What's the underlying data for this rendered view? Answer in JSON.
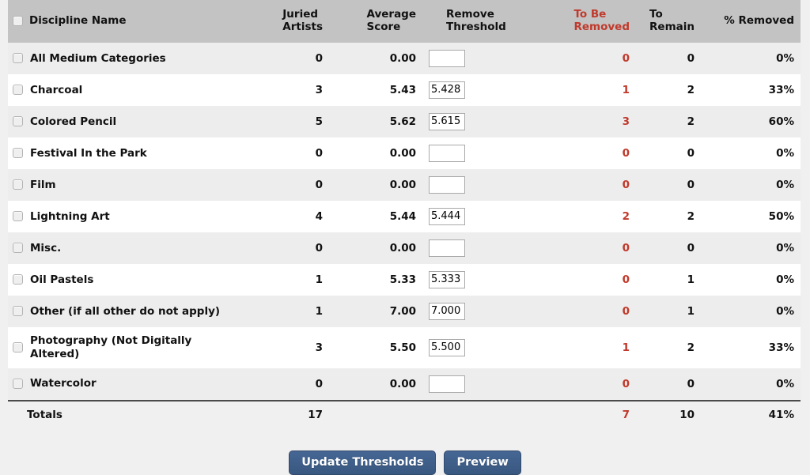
{
  "table": {
    "columns": [
      {
        "key": "name",
        "label": "Discipline Name",
        "align": "left",
        "red": false
      },
      {
        "key": "juried",
        "label": "Juried Artists",
        "align": "right",
        "red": false
      },
      {
        "key": "avg",
        "label": "Average Score",
        "align": "right",
        "red": false
      },
      {
        "key": "threshold",
        "label": "Remove Threshold",
        "align": "right",
        "red": false
      },
      {
        "key": "to_remove",
        "label": "To Be Removed",
        "align": "right",
        "red": true
      },
      {
        "key": "to_remain",
        "label": "To Remain",
        "align": "right",
        "red": false
      },
      {
        "key": "pct_removed",
        "label": "% Removed",
        "align": "right",
        "red": false
      }
    ],
    "header": {
      "discipline_name": "Discipline Name",
      "juried_artists_l1": "Juried",
      "juried_artists_l2": "Artists",
      "average_score_l1": "Average",
      "average_score_l2": "Score",
      "remove_threshold_l1": "Remove",
      "remove_threshold_l2": "Threshold",
      "to_be_removed_l1": "To Be",
      "to_be_removed_l2": "Removed",
      "to_remain_l1": "To",
      "to_remain_l2": "Remain",
      "pct_removed": "% Removed",
      "select_all_checkbox": "unchecked"
    },
    "rows": [
      {
        "name": "All Medium Categories",
        "juried": "0",
        "avg": "0.00",
        "threshold": "",
        "threshold_placeholder": "",
        "to_remove": "0",
        "to_remain": "0",
        "pct_removed": "0%"
      },
      {
        "name": "Charcoal",
        "juried": "3",
        "avg": "5.43",
        "threshold": "5.428",
        "threshold_placeholder": "",
        "to_remove": "1",
        "to_remain": "2",
        "pct_removed": "33%"
      },
      {
        "name": "Colored Pencil",
        "juried": "5",
        "avg": "5.62",
        "threshold": "5.615",
        "threshold_placeholder": "",
        "to_remove": "3",
        "to_remain": "2",
        "pct_removed": "60%"
      },
      {
        "name": "Festival In the Park",
        "juried": "0",
        "avg": "0.00",
        "threshold": "",
        "threshold_placeholder": "",
        "to_remove": "0",
        "to_remain": "0",
        "pct_removed": "0%"
      },
      {
        "name": "Film",
        "juried": "0",
        "avg": "0.00",
        "threshold": "",
        "threshold_placeholder": "",
        "to_remove": "0",
        "to_remain": "0",
        "pct_removed": "0%"
      },
      {
        "name": "Lightning Art",
        "juried": "4",
        "avg": "5.44",
        "threshold": "5.444",
        "threshold_placeholder": "",
        "to_remove": "2",
        "to_remain": "2",
        "pct_removed": "50%"
      },
      {
        "name": "Misc.",
        "juried": "0",
        "avg": "0.00",
        "threshold": "",
        "threshold_placeholder": "",
        "to_remove": "0",
        "to_remain": "0",
        "pct_removed": "0%"
      },
      {
        "name": "Oil Pastels",
        "juried": "1",
        "avg": "5.33",
        "threshold": "5.333",
        "threshold_placeholder": "",
        "to_remove": "0",
        "to_remain": "1",
        "pct_removed": "0%"
      },
      {
        "name": "Other (if all other do not apply)",
        "juried": "1",
        "avg": "7.00",
        "threshold": "7.000",
        "threshold_placeholder": "",
        "to_remove": "0",
        "to_remain": "1",
        "pct_removed": "0%"
      },
      {
        "name": "Photography (Not Digitally Altered)",
        "juried": "3",
        "avg": "5.50",
        "threshold": "5.500",
        "threshold_placeholder": "",
        "to_remove": "1",
        "to_remain": "2",
        "pct_removed": "33%"
      },
      {
        "name": "Watercolor",
        "juried": "0",
        "avg": "0.00",
        "threshold": "",
        "threshold_placeholder": "",
        "to_remove": "0",
        "to_remain": "0",
        "pct_removed": "0%"
      }
    ],
    "totals": {
      "label": "Totals",
      "juried": "17",
      "avg": "",
      "threshold": "",
      "to_remove": "7",
      "to_remain": "10",
      "pct_removed": "41%"
    }
  },
  "actions": {
    "update_thresholds_label": "Update Thresholds",
    "preview_label": "Preview"
  },
  "colors": {
    "header_background": "#c3c3c3",
    "accent_red": "#c0392b",
    "button_blue": "#3c5d8a",
    "row_stripe": "#ededed",
    "page_background": "#f0f0f0"
  }
}
